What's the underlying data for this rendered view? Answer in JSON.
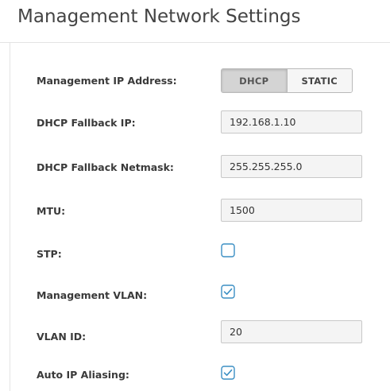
{
  "panel": {
    "title": "Management Network Settings"
  },
  "form": {
    "mgmt_ip": {
      "label": "Management IP Address:",
      "options": [
        "DHCP",
        "STATIC"
      ],
      "selected": "DHCP"
    },
    "fallback_ip": {
      "label": "DHCP Fallback IP:",
      "value": "192.168.1.10"
    },
    "fallback_netmask": {
      "label": "DHCP Fallback Netmask:",
      "value": "255.255.255.0"
    },
    "mtu": {
      "label": "MTU:",
      "value": "1500"
    },
    "stp": {
      "label": "STP:",
      "checked": false
    },
    "mgmt_vlan": {
      "label": "Management VLAN:",
      "checked": true
    },
    "vlan_id": {
      "label": "VLAN ID:",
      "value": "20"
    },
    "auto_ip_aliasing": {
      "label": "Auto IP Aliasing:",
      "checked": true
    }
  },
  "colors": {
    "checkbox": "#3b8fc4",
    "toggle_active": "#d4d4d4"
  }
}
